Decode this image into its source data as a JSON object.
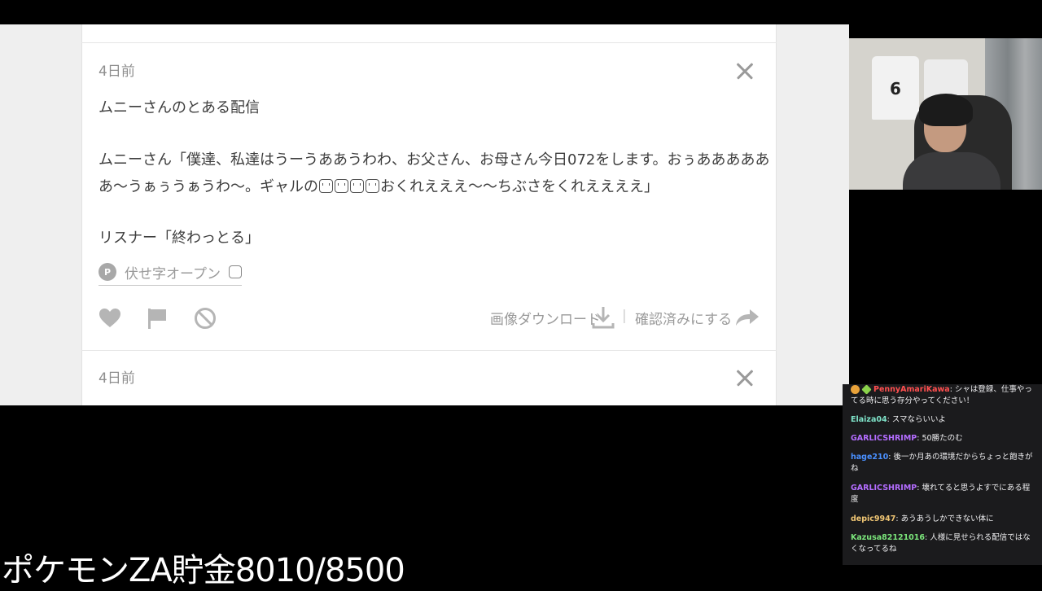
{
  "feed": {
    "cards": [
      {
        "time": "4日前",
        "title": "ムニーさんのとある配信",
        "line1": "ムニーさん「僕達、私達はうーうああうわわ、お父さん、お母さん今日072をします。おぅあああああ",
        "line2a": "あ〜うぁぅうぁうわ〜。ギャルの",
        "line2b": "おくれえええ〜〜ちぶさをくれええええ」",
        "line3": "リスナー「終わっとる」",
        "spoiler_badge": "P",
        "spoiler_label": "伏せ字オープン",
        "download_label": "画像ダウンロード",
        "separator": "|",
        "confirm_label": "確認済みにする"
      },
      {
        "time": "4日前"
      }
    ]
  },
  "chat": {
    "messages": [
      {
        "user": "PennyAmariKawa",
        "text": ": シャは登録、仕事やってる時に思う存分やってください！",
        "color": "#ff4f4f"
      },
      {
        "user": "Elaiza04",
        "text": ": スマならいいよ",
        "color": "#7fe3c9"
      },
      {
        "user": "GARLICSHRIMP",
        "text": ": 50勝たのむ",
        "color": "#b46dff"
      },
      {
        "user": "hage210",
        "text": ": 後一か月あの環境だからちょっと飽きがね",
        "color": "#4a90ff"
      },
      {
        "user": "GARLICSHRIMP",
        "text": ": 壊れてると思うよすでにある程度",
        "color": "#b46dff"
      },
      {
        "user": "depic9947",
        "text": ": あうあうしかできない体に",
        "color": "#f0c674"
      },
      {
        "user": "Kazusa82121016",
        "text": ": 人様に見せられる配信ではなくなってるね",
        "color": "#7be67b"
      }
    ]
  },
  "overlay": {
    "goal_text": "ポケモンZA貯金8010/8500"
  },
  "webcam": {
    "jersey_number": "6"
  }
}
